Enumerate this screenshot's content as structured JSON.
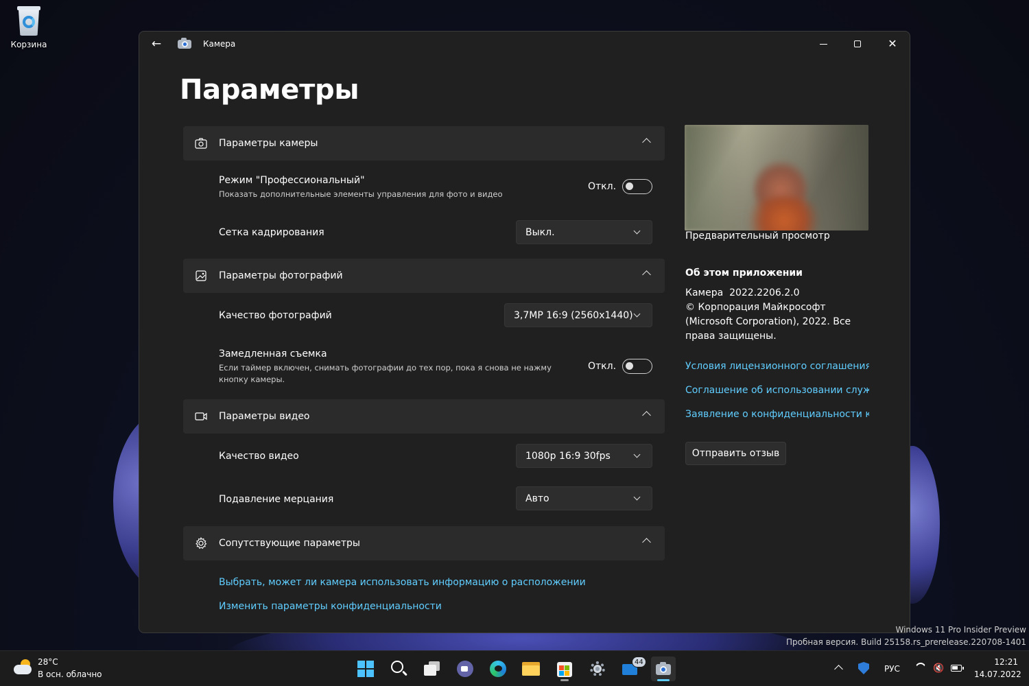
{
  "desktop": {
    "recycle_bin_label": "Корзина",
    "watermark_line1": "Windows 11 Pro Insider Preview",
    "watermark_line2": "Пробная версия. Build 25158.rs_prerelease.220708-1401"
  },
  "window": {
    "title": "Камера",
    "page_title": "Параметры"
  },
  "sections": {
    "camera": {
      "label": "Параметры камеры",
      "pro_mode_label": "Режим \"Профессиональный\"",
      "pro_mode_desc": "Показать дополнительные элементы управления для фото и видео",
      "pro_mode_state": "Откл.",
      "pro_mode_on": false,
      "grid_label": "Сетка кадрирования",
      "grid_value": "Выкл."
    },
    "photo": {
      "label": "Параметры фотографий",
      "quality_label": "Качество фотографий",
      "quality_value": "3,7MP 16:9 (2560x1440)",
      "timelapse_label": "Замедленная съемка",
      "timelapse_desc_line1": "Если таймер включен, снимать фотографии до тех пор, пока я снова не нажму",
      "timelapse_desc_line2": "кнопку камеры.",
      "timelapse_state": "Откл.",
      "timelapse_on": false
    },
    "video": {
      "label": "Параметры видео",
      "quality_label": "Качество видео",
      "quality_value": "1080p 16:9 30fps",
      "flicker_label": "Подавление мерцания",
      "flicker_value": "Авто"
    },
    "related": {
      "label": "Сопутствующие параметры",
      "location_link": "Выбрать, может ли камера использовать информацию о расположении",
      "privacy_link": "Изменить параметры конфиденциальности"
    }
  },
  "sidebar": {
    "preview_caption": "Предварительный просмотр",
    "about_title": "Об этом приложении",
    "app_name": "Камера",
    "app_version": "2022.2206.2.0",
    "copyright_line1": "© Корпорация Майкрософт",
    "copyright_line2": "(Microsoft Corporation), 2022. Все",
    "copyright_line3": "права защищены.",
    "license_link": "Условия лицензионного соглашения на",
    "services_link": "Соглашение об использовании служб",
    "privacy_statement_link": "Заявление о конфиденциальности корпорации",
    "feedback_button": "Отправить отзыв"
  },
  "taskbar": {
    "weather_temp": "28°C",
    "weather_desc": "В осн. облачно",
    "mail_badge": "44",
    "language": "РУС",
    "time": "12:21",
    "date": "14.07.2022",
    "accent_color": "#60cdff"
  }
}
